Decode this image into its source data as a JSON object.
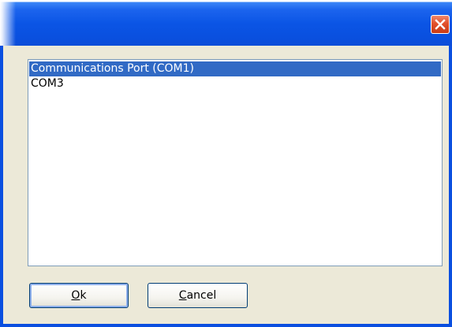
{
  "window": {
    "title": "",
    "close_icon": "close-icon",
    "accent_color": "#0a4fe0",
    "close_color": "#e2512c"
  },
  "listbox": {
    "items": [
      {
        "label": "Communications Port (COM1)",
        "selected": true
      },
      {
        "label": "COM3",
        "selected": false
      }
    ],
    "selection_color": "#316ac5"
  },
  "buttons": {
    "ok": {
      "mnemonic": "O",
      "rest": "k"
    },
    "cancel": {
      "mnemonic": "C",
      "rest": "ancel"
    }
  }
}
